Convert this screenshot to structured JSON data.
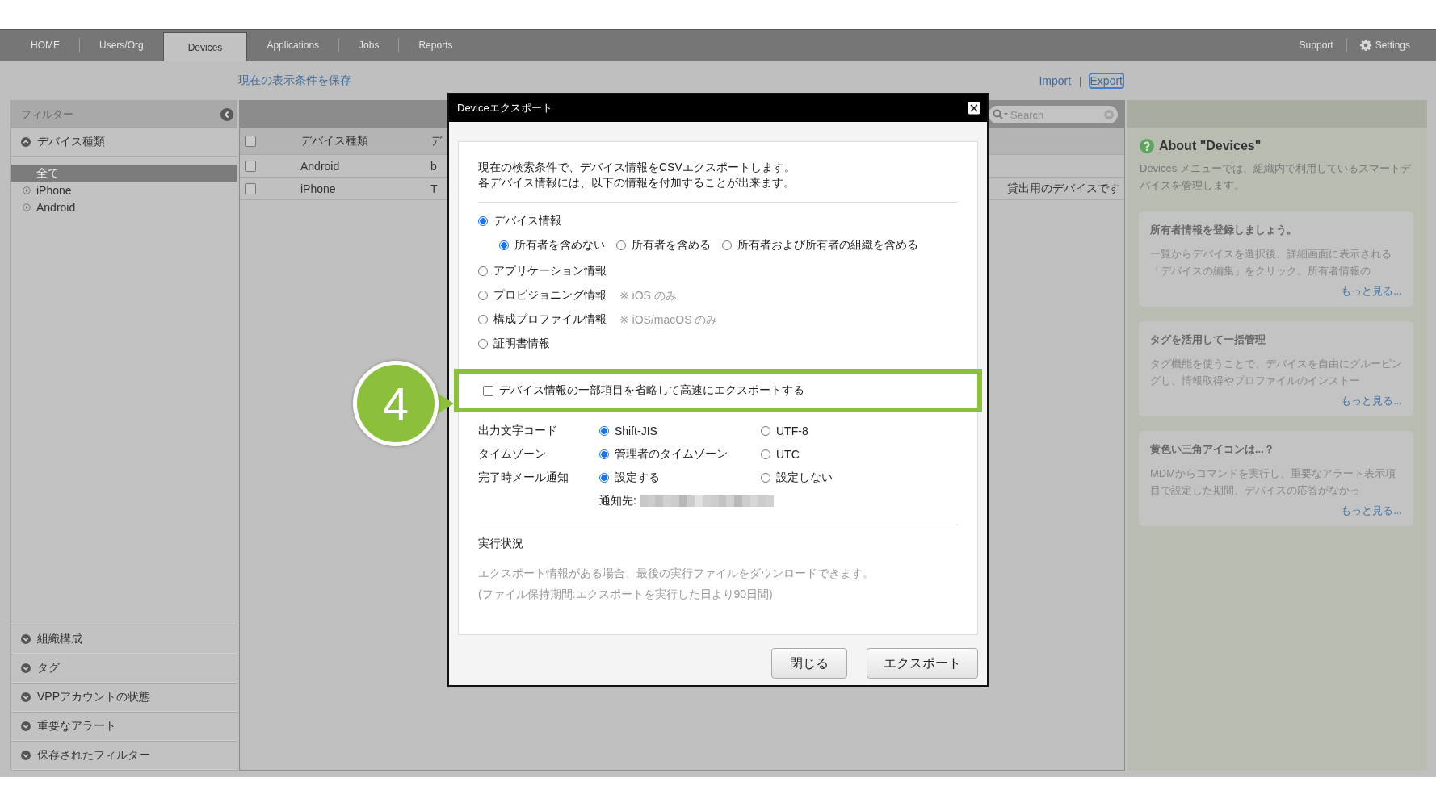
{
  "nav": {
    "tabs": [
      {
        "label": "HOME",
        "selected": false
      },
      {
        "label": "Users/Org",
        "selected": false
      },
      {
        "label": "Devices",
        "selected": true
      },
      {
        "label": "Applications",
        "selected": false
      },
      {
        "label": "Jobs",
        "selected": false
      },
      {
        "label": "Reports",
        "selected": false
      }
    ],
    "right": [
      {
        "label": "Support",
        "kind": "text"
      },
      {
        "label": "Settings",
        "kind": "gear"
      }
    ]
  },
  "save_link": "現在の表示条件を保存",
  "action_divider": "|",
  "actions": [
    {
      "label": "Import",
      "focused": false
    },
    {
      "label": "Export",
      "focused": true
    }
  ],
  "sidebar": {
    "title": "フィルター",
    "device_types": {
      "label": "デバイス種類",
      "expanded": true,
      "items": [
        {
          "label": "全て",
          "selected": true
        },
        {
          "label": "iPhone",
          "selected": false
        },
        {
          "label": "Android",
          "selected": false
        }
      ]
    },
    "sections": [
      {
        "label": "組織構成",
        "expanded": false
      },
      {
        "label": "タグ",
        "expanded": false
      },
      {
        "label": "VPPアカウントの状態",
        "expanded": false
      },
      {
        "label": "重要なアラート",
        "expanded": false
      },
      {
        "label": "保存されたフィルター",
        "expanded": false
      }
    ]
  },
  "table": {
    "search": {
      "placeholder": "Search"
    },
    "header_checked": false,
    "columns": [
      "デバイス種類",
      "デ"
    ],
    "rows": [
      {
        "checked": false,
        "column_1": "Android",
        "column_2": "b"
      },
      {
        "checked": false,
        "column_1": "iPhone",
        "column_2": "T",
        "column_3": "貸出用のデバイスです"
      }
    ]
  },
  "about": {
    "title": "About \"Devices\"",
    "text": "Devices メニューでは、組織内で利用しているスマートデバイスを管理します。",
    "tips": [
      {
        "title": "所有者情報を登録しましょう。",
        "text": "一覧からデバイスを選択後、詳細画面に表示される「デバイスの編集」をクリック。所有者情報の",
        "more": "もっと見る..."
      },
      {
        "title": "タグを活用して一括管理",
        "text": "タグ機能を使うことで、デバイスを自由にグルーピングし、情報取得やプロファイルのインストー",
        "more": "もっと見る..."
      },
      {
        "title": "黄色い三角アイコンは...？",
        "text": "MDMからコマンドを実行し、重要なアラート表示項目で設定した期間、デバイスの応答がなかっ",
        "more": "もっと見る..."
      }
    ]
  },
  "dialog": {
    "title": "Deviceエクスポート",
    "intro": [
      "現在の検索条件で、デバイス情報をCSVエクスポートします。",
      "各デバイス情報には、以下の情報を付加することが出来ます。"
    ],
    "info_types": [
      {
        "label": "デバイス情報",
        "selected": true,
        "options": [
          {
            "label": "所有者を含めない",
            "selected": true
          },
          {
            "label": "所有者を含める",
            "selected": false
          },
          {
            "label": "所有者および所有者の組織を含める",
            "selected": false
          }
        ]
      },
      {
        "label": "アプリケーション情報",
        "selected": false
      },
      {
        "label": "プロビジョニング情報",
        "selected": false,
        "note": "※ iOS のみ"
      },
      {
        "label": "構成プロファイル情報",
        "selected": false,
        "note": "※ iOS/macOS のみ"
      },
      {
        "label": "証明書情報",
        "selected": false
      }
    ],
    "fast_export": {
      "label": "デバイス情報の一部項目を省略して高速にエクスポートする",
      "checked": false
    },
    "settings": [
      {
        "label": "出力文字コード",
        "options": [
          {
            "label": "Shift-JIS",
            "selected": true
          },
          {
            "label": "UTF-8",
            "selected": false
          }
        ]
      },
      {
        "label": "タイムゾーン",
        "options": [
          {
            "label": "管理者のタイムゾーン",
            "selected": true
          },
          {
            "label": "UTC",
            "selected": false
          }
        ]
      },
      {
        "label": "完了時メール通知",
        "options": [
          {
            "label": "設定する",
            "selected": true
          },
          {
            "label": "設定しない",
            "selected": false
          }
        ]
      }
    ],
    "notify_label": "通知先:",
    "status": {
      "title": "実行状況",
      "lines": [
        "エクスポート情報がある場合、最後の実行ファイルをダウンロードできます。",
        "(ファイル保持期間:エクスポートを実行した日より90日間)"
      ]
    },
    "buttons": [
      "閉じる",
      "エクスポート"
    ]
  },
  "step_marker": "4"
}
